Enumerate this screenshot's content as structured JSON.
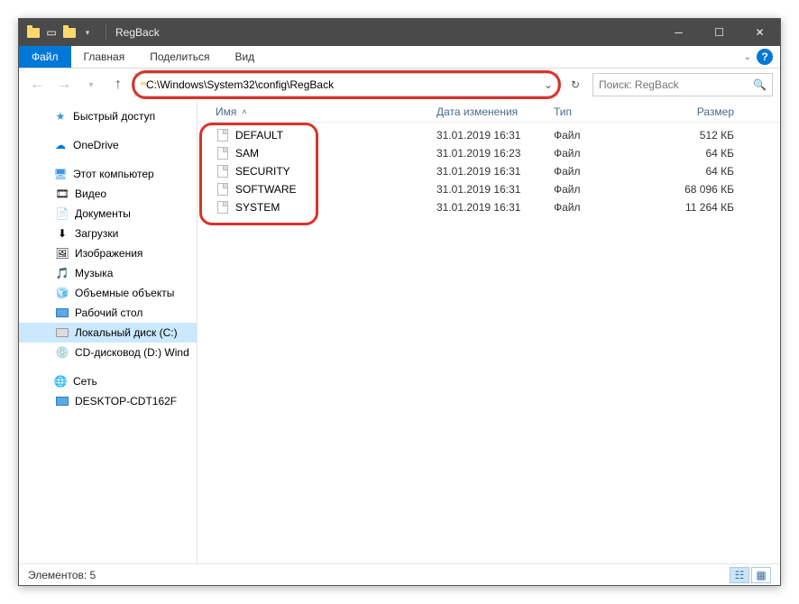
{
  "window": {
    "title": "RegBack"
  },
  "ribbon": {
    "file": "Файл",
    "tabs": [
      "Главная",
      "Поделиться",
      "Вид"
    ]
  },
  "nav": {
    "address": "C:\\Windows\\System32\\config\\RegBack",
    "refresh_icon": "↻",
    "search_placeholder": "Поиск: RegBack"
  },
  "sidebar": {
    "quick": "Быстрый доступ",
    "onedrive": "OneDrive",
    "pc": "Этот компьютер",
    "pc_items": [
      "Видео",
      "Документы",
      "Загрузки",
      "Изображения",
      "Музыка",
      "Объемные объекты",
      "Рабочий стол",
      "Локальный диск (C:)",
      "CD-дисковод (D:) Wind"
    ],
    "network": "Сеть",
    "net_items": [
      "DESKTOP-CDT162F"
    ]
  },
  "columns": {
    "name": "Имя",
    "date": "Дата изменения",
    "type": "Тип",
    "size": "Размер"
  },
  "files": [
    {
      "name": "DEFAULT",
      "date": "31.01.2019 16:31",
      "type": "Файл",
      "size": "512 КБ"
    },
    {
      "name": "SAM",
      "date": "31.01.2019 16:23",
      "type": "Файл",
      "size": "64 КБ"
    },
    {
      "name": "SECURITY",
      "date": "31.01.2019 16:31",
      "type": "Файл",
      "size": "64 КБ"
    },
    {
      "name": "SOFTWARE",
      "date": "31.01.2019 16:31",
      "type": "Файл",
      "size": "68 096 КБ"
    },
    {
      "name": "SYSTEM",
      "date": "31.01.2019 16:31",
      "type": "Файл",
      "size": "11 264 КБ"
    }
  ],
  "status": {
    "count_label": "Элементов: 5"
  }
}
